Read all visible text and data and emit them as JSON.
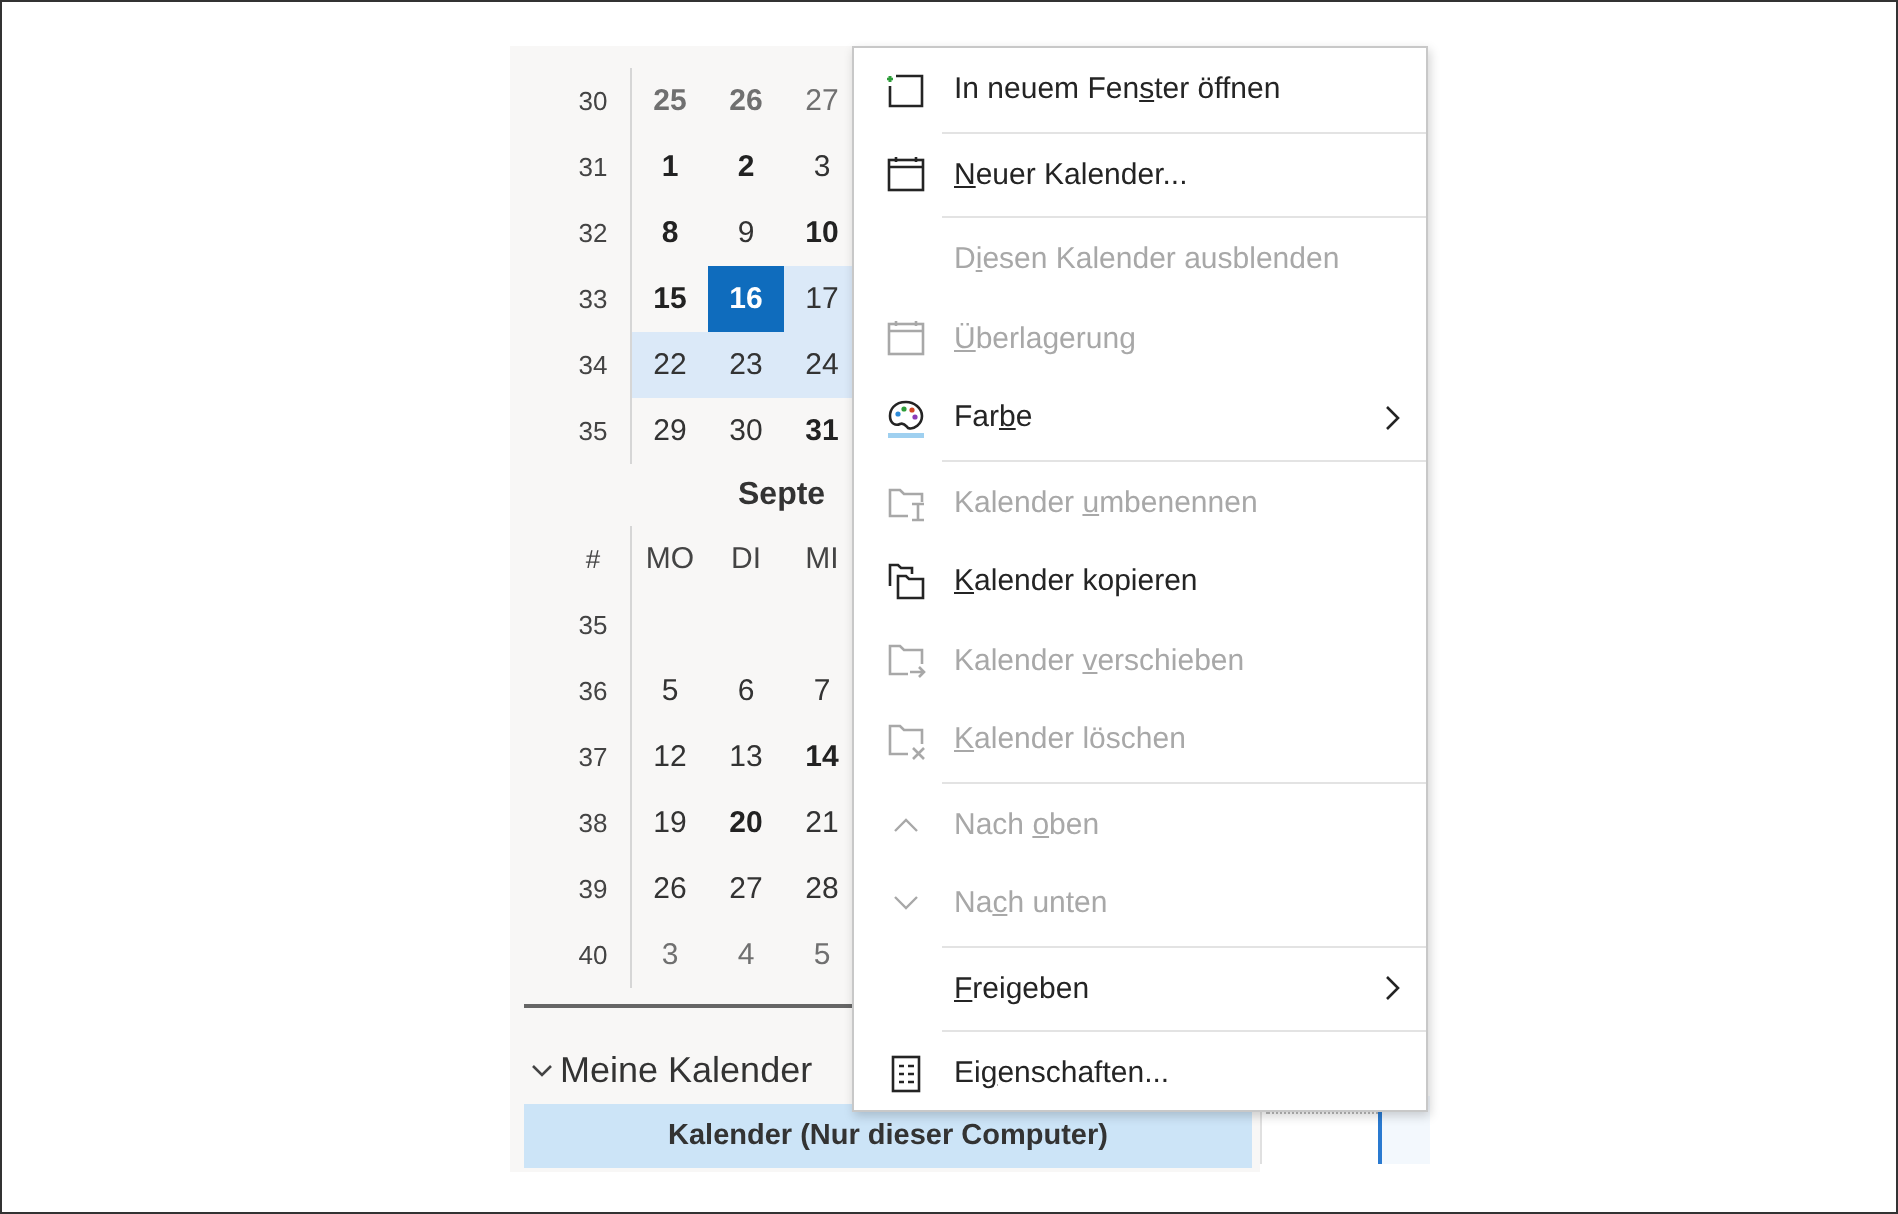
{
  "calendar": {
    "weeks": [
      {
        "week": "30",
        "days": [
          {
            "text": "25",
            "bold": true,
            "other_month": true,
            "selected": false,
            "in_range": false
          },
          {
            "text": "26",
            "bold": true,
            "other_month": true,
            "selected": false,
            "in_range": false
          },
          {
            "text": "27",
            "bold": false,
            "other_month": true,
            "selected": false,
            "in_range": false
          }
        ]
      },
      {
        "week": "31",
        "days": [
          {
            "text": "1",
            "bold": true,
            "other_month": false,
            "selected": false,
            "in_range": false
          },
          {
            "text": "2",
            "bold": true,
            "other_month": false,
            "selected": false,
            "in_range": false
          },
          {
            "text": "3",
            "bold": false,
            "other_month": false,
            "selected": false,
            "in_range": false
          }
        ]
      },
      {
        "week": "32",
        "days": [
          {
            "text": "8",
            "bold": true,
            "other_month": false,
            "selected": false,
            "in_range": false
          },
          {
            "text": "9",
            "bold": false,
            "other_month": false,
            "selected": false,
            "in_range": false
          },
          {
            "text": "10",
            "bold": true,
            "other_month": false,
            "selected": false,
            "in_range": false
          }
        ]
      },
      {
        "week": "33",
        "days": [
          {
            "text": "15",
            "bold": true,
            "other_month": false,
            "selected": false,
            "in_range": false
          },
          {
            "text": "16",
            "bold": true,
            "other_month": false,
            "selected": true,
            "in_range": true
          },
          {
            "text": "17",
            "bold": false,
            "other_month": false,
            "selected": false,
            "in_range": true
          }
        ]
      },
      {
        "week": "34",
        "days": [
          {
            "text": "22",
            "bold": false,
            "other_month": false,
            "selected": false,
            "in_range": true
          },
          {
            "text": "23",
            "bold": false,
            "other_month": false,
            "selected": false,
            "in_range": true
          },
          {
            "text": "24",
            "bold": false,
            "other_month": false,
            "selected": false,
            "in_range": true
          }
        ]
      },
      {
        "week": "35",
        "days": [
          {
            "text": "29",
            "bold": false,
            "other_month": false,
            "selected": false,
            "in_range": false
          },
          {
            "text": "30",
            "bold": false,
            "other_month": false,
            "selected": false,
            "in_range": false
          },
          {
            "text": "31",
            "bold": true,
            "other_month": false,
            "selected": false,
            "in_range": false
          }
        ]
      }
    ],
    "month2": {
      "title": "Septe",
      "week_header": "#",
      "day_headers": [
        "MO",
        "DI",
        "MI"
      ],
      "weeks": [
        {
          "week": "35"
        },
        {
          "week": "36",
          "days": [
            {
              "text": "5",
              "bold": false,
              "other_month": false
            },
            {
              "text": "6",
              "bold": false,
              "other_month": false
            },
            {
              "text": "7",
              "bold": false,
              "other_month": false
            }
          ]
        },
        {
          "week": "37",
          "days": [
            {
              "text": "12",
              "bold": false,
              "other_month": false
            },
            {
              "text": "13",
              "bold": false,
              "other_month": false
            },
            {
              "text": "14",
              "bold": true,
              "other_month": false
            }
          ]
        },
        {
          "week": "38",
          "days": [
            {
              "text": "19",
              "bold": false,
              "other_month": false
            },
            {
              "text": "20",
              "bold": true,
              "other_month": false
            },
            {
              "text": "21",
              "bold": false,
              "other_month": false
            }
          ]
        },
        {
          "week": "39",
          "days": [
            {
              "text": "26",
              "bold": false,
              "other_month": false
            },
            {
              "text": "27",
              "bold": false,
              "other_month": false
            },
            {
              "text": "28",
              "bold": false,
              "other_month": false
            }
          ]
        },
        {
          "week": "40",
          "days": [
            {
              "text": "3",
              "bold": false,
              "other_month": true
            },
            {
              "text": "4",
              "bold": false,
              "other_month": true
            },
            {
              "text": "5",
              "bold": false,
              "other_month": true
            }
          ]
        }
      ]
    }
  },
  "folders": {
    "group": "Meine Kalender",
    "expanded": true,
    "items": [
      {
        "label": "Kalender (Nur dieser Computer)",
        "selected": true
      }
    ]
  },
  "context_menu": {
    "groups": [
      [
        {
          "label": {
            "before": "In neuem Fen",
            "key": "s",
            "after": "ter öffnen"
          },
          "disabled": false,
          "submenu": false
        }
      ],
      [
        {
          "label": {
            "key": "N",
            "after": "euer Kalender..."
          },
          "disabled": false,
          "submenu": false
        }
      ],
      [
        {
          "label": {
            "before": "D",
            "key": "i",
            "after": "esen Kalender ausblenden"
          },
          "disabled": true,
          "submenu": false
        },
        {
          "label": {
            "key": "Ü",
            "after": "berlagerung"
          },
          "disabled": true,
          "submenu": false
        },
        {
          "label": {
            "before": "Far",
            "key": "b",
            "after": "e"
          },
          "disabled": false,
          "submenu": true
        }
      ],
      [
        {
          "label": {
            "before": "Kalender ",
            "key": "u",
            "after": "mbenennen"
          },
          "disabled": true,
          "submenu": false
        },
        {
          "label": {
            "key": "K",
            "after": "alender kopieren"
          },
          "disabled": false,
          "submenu": false
        },
        {
          "label": {
            "before": "Kalender ",
            "key": "v",
            "after": "erschieben"
          },
          "disabled": true,
          "submenu": false
        },
        {
          "label": {
            "key": "K",
            "after": "alender löschen"
          },
          "disabled": true,
          "submenu": false
        }
      ],
      [
        {
          "label": {
            "before": "Nach ",
            "key": "o",
            "after": "ben"
          },
          "disabled": true,
          "submenu": false
        },
        {
          "label": {
            "before": "Na",
            "key": "c",
            "after": "h unten"
          },
          "disabled": true,
          "submenu": false
        }
      ],
      [
        {
          "label": {
            "key": "F",
            "after": "reigeben"
          },
          "disabled": false,
          "submenu": true
        }
      ],
      [
        {
          "label": {
            "before": "Ei",
            "key": "g",
            "after": "enschaften..."
          },
          "disabled": false,
          "submenu": false
        }
      ]
    ]
  }
}
